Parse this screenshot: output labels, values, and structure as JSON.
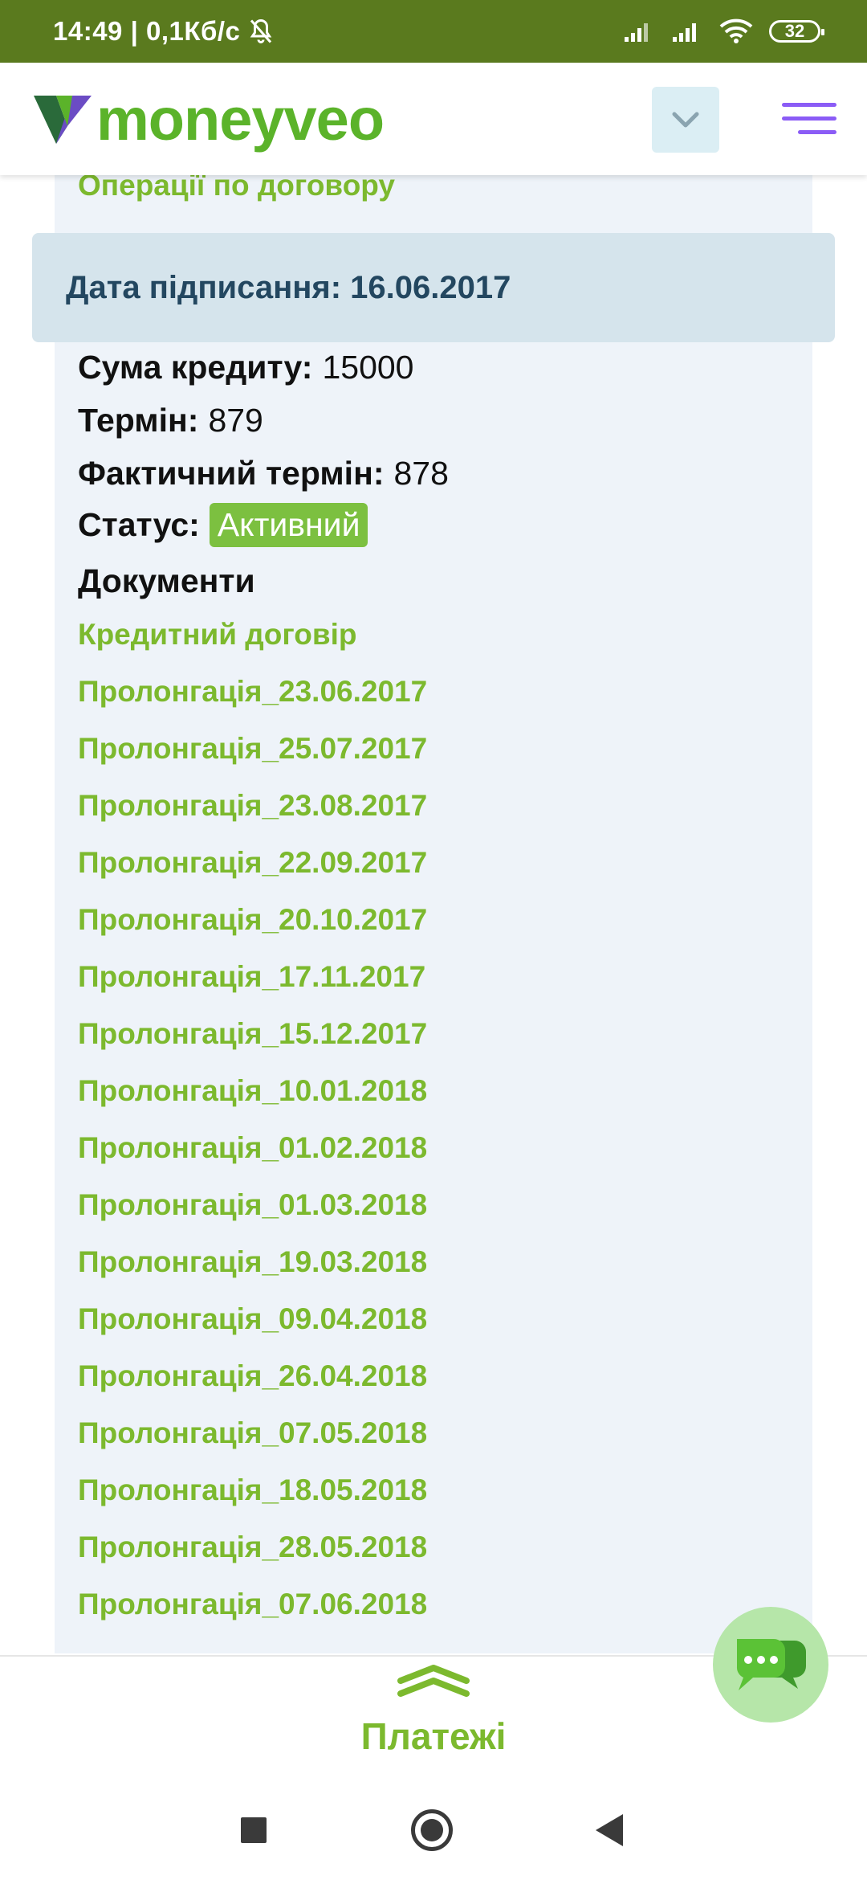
{
  "status_bar": {
    "time": "14:49",
    "speed": "0,1Кб/с",
    "battery": "32"
  },
  "header": {
    "logo_text": "moneyveo",
    "brand_color": "#5bb32a",
    "menu_color": "#8b5cf6"
  },
  "contract": {
    "operations_link": "Операції по договору",
    "date_label": "Дата підписання: 16.06.2017",
    "fields": [
      {
        "label": "Сума кредиту:",
        "value": "15000"
      },
      {
        "label": "Термін:",
        "value": "879"
      },
      {
        "label": "Фактичний термін:",
        "value": "878"
      }
    ],
    "status_label": "Статус:",
    "status_value": "Активний",
    "documents_title": "Документи",
    "documents": [
      "Кредитний договір",
      "Пролонгація_23.06.2017",
      "Пролонгація_25.07.2017",
      "Пролонгація_23.08.2017",
      "Пролонгація_22.09.2017",
      "Пролонгація_20.10.2017",
      "Пролонгація_17.11.2017",
      "Пролонгація_15.12.2017",
      "Пролонгація_10.01.2018",
      "Пролонгація_01.02.2018",
      "Пролонгація_01.03.2018",
      "Пролонгація_19.03.2018",
      "Пролонгація_09.04.2018",
      "Пролонгація_26.04.2018",
      "Пролонгація_07.05.2018",
      "Пролонгація_18.05.2018",
      "Пролонгація_28.05.2018",
      "Пролонгація_07.06.2018"
    ]
  },
  "bottom": {
    "payments_label": "Платежі"
  },
  "icons": {
    "dropdown": "chevron-down-icon",
    "menu": "hamburger-menu-icon",
    "chat": "chat-bubbles-icon",
    "payments": "double-chevron-up-icon"
  }
}
